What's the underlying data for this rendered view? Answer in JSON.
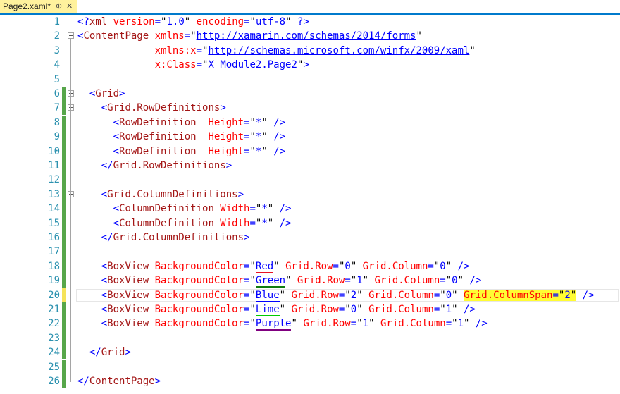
{
  "tab": {
    "title": "Page2.xaml*",
    "pin_glyph": "⊕",
    "close_glyph": "✕"
  },
  "colors": {
    "line_number": "#2b91af",
    "bracket": "#0000ff",
    "element": "#a31515",
    "attribute": "#ff0000",
    "string": "#0000ff",
    "change_saved": "#57a64a",
    "change_unsaved": "#f5e35a",
    "highlight": "#fffc33"
  },
  "lines": [
    {
      "n": "1",
      "change": "",
      "fold": false,
      "tokens": [
        [
          "br",
          "<?"
        ],
        [
          "el",
          "xml"
        ],
        [
          "at",
          " version"
        ],
        [
          "br",
          "="
        ],
        [
          "tx",
          "\""
        ],
        [
          "st",
          "1.0"
        ],
        [
          "tx",
          "\""
        ],
        [
          "at",
          " encoding"
        ],
        [
          "br",
          "="
        ],
        [
          "tx",
          "\""
        ],
        [
          "st",
          "utf-8"
        ],
        [
          "tx",
          "\""
        ],
        [
          "br",
          " ?>"
        ]
      ]
    },
    {
      "n": "2",
      "change": "",
      "fold": true,
      "tokens": [
        [
          "br",
          "<"
        ],
        [
          "el",
          "ContentPage"
        ],
        [
          "at",
          " xmlns"
        ],
        [
          "br",
          "="
        ],
        [
          "tx",
          "\""
        ],
        [
          "url",
          "http://xamarin.com/schemas/2014/forms"
        ],
        [
          "tx",
          "\""
        ]
      ]
    },
    {
      "n": "3",
      "change": "",
      "fold": false,
      "tokens": [
        [
          "tx",
          "             "
        ],
        [
          "at",
          "xmlns:x"
        ],
        [
          "br",
          "="
        ],
        [
          "tx",
          "\""
        ],
        [
          "url",
          "http://schemas.microsoft.com/winfx/2009/xaml"
        ],
        [
          "tx",
          "\""
        ]
      ]
    },
    {
      "n": "4",
      "change": "",
      "fold": false,
      "tokens": [
        [
          "tx",
          "             "
        ],
        [
          "at",
          "x:Class"
        ],
        [
          "br",
          "="
        ],
        [
          "tx",
          "\""
        ],
        [
          "st",
          "X_Module2.Page2"
        ],
        [
          "tx",
          "\""
        ],
        [
          "br",
          ">"
        ]
      ]
    },
    {
      "n": "5",
      "change": "",
      "fold": false,
      "tokens": []
    },
    {
      "n": "6",
      "change": "saved",
      "fold": true,
      "tokens": [
        [
          "tx",
          "  "
        ],
        [
          "br",
          "<"
        ],
        [
          "el",
          "Grid"
        ],
        [
          "br",
          ">"
        ]
      ]
    },
    {
      "n": "7",
      "change": "saved",
      "fold": true,
      "tokens": [
        [
          "tx",
          "    "
        ],
        [
          "br",
          "<"
        ],
        [
          "el",
          "Grid.RowDefinitions"
        ],
        [
          "br",
          ">"
        ]
      ]
    },
    {
      "n": "8",
      "change": "saved",
      "fold": false,
      "tokens": [
        [
          "tx",
          "      "
        ],
        [
          "br",
          "<"
        ],
        [
          "el",
          "RowDefinition"
        ],
        [
          "at",
          "  Height"
        ],
        [
          "br",
          "="
        ],
        [
          "tx",
          "\""
        ],
        [
          "st",
          "*"
        ],
        [
          "tx",
          "\""
        ],
        [
          "br",
          " />"
        ]
      ]
    },
    {
      "n": "9",
      "change": "saved",
      "fold": false,
      "tokens": [
        [
          "tx",
          "      "
        ],
        [
          "br",
          "<"
        ],
        [
          "el",
          "RowDefinition"
        ],
        [
          "at",
          "  Height"
        ],
        [
          "br",
          "="
        ],
        [
          "tx",
          "\""
        ],
        [
          "st",
          "*"
        ],
        [
          "tx",
          "\""
        ],
        [
          "br",
          " />"
        ]
      ]
    },
    {
      "n": "10",
      "change": "saved",
      "fold": false,
      "tokens": [
        [
          "tx",
          "      "
        ],
        [
          "br",
          "<"
        ],
        [
          "el",
          "RowDefinition"
        ],
        [
          "at",
          "  Height"
        ],
        [
          "br",
          "="
        ],
        [
          "tx",
          "\""
        ],
        [
          "st",
          "*"
        ],
        [
          "tx",
          "\""
        ],
        [
          "br",
          " />"
        ]
      ]
    },
    {
      "n": "11",
      "change": "saved",
      "fold": false,
      "tokens": [
        [
          "tx",
          "    "
        ],
        [
          "br",
          "</"
        ],
        [
          "el",
          "Grid.RowDefinitions"
        ],
        [
          "br",
          ">"
        ]
      ]
    },
    {
      "n": "12",
      "change": "saved",
      "fold": false,
      "tokens": []
    },
    {
      "n": "13",
      "change": "saved",
      "fold": true,
      "tokens": [
        [
          "tx",
          "    "
        ],
        [
          "br",
          "<"
        ],
        [
          "el",
          "Grid.ColumnDefinitions"
        ],
        [
          "br",
          ">"
        ]
      ]
    },
    {
      "n": "14",
      "change": "saved",
      "fold": false,
      "tokens": [
        [
          "tx",
          "      "
        ],
        [
          "br",
          "<"
        ],
        [
          "el",
          "ColumnDefinition"
        ],
        [
          "at",
          " Width"
        ],
        [
          "br",
          "="
        ],
        [
          "tx",
          "\""
        ],
        [
          "st",
          "*"
        ],
        [
          "tx",
          "\""
        ],
        [
          "br",
          " />"
        ]
      ]
    },
    {
      "n": "15",
      "change": "saved",
      "fold": false,
      "tokens": [
        [
          "tx",
          "      "
        ],
        [
          "br",
          "<"
        ],
        [
          "el",
          "ColumnDefinition"
        ],
        [
          "at",
          " Width"
        ],
        [
          "br",
          "="
        ],
        [
          "tx",
          "\""
        ],
        [
          "st",
          "*"
        ],
        [
          "tx",
          "\""
        ],
        [
          "br",
          " />"
        ]
      ]
    },
    {
      "n": "16",
      "change": "saved",
      "fold": false,
      "tokens": [
        [
          "tx",
          "    "
        ],
        [
          "br",
          "</"
        ],
        [
          "el",
          "Grid.ColumnDefinitions"
        ],
        [
          "br",
          ">"
        ]
      ]
    },
    {
      "n": "17",
      "change": "saved",
      "fold": false,
      "tokens": []
    },
    {
      "n": "18",
      "change": "saved",
      "fold": false,
      "tokens": [
        [
          "tx",
          "    "
        ],
        [
          "br",
          "<"
        ],
        [
          "el",
          "BoxView"
        ],
        [
          "at",
          " BackgroundColor"
        ],
        [
          "br",
          "="
        ],
        [
          "tx",
          "\""
        ],
        [
          "st",
          "Red",
          "ul-red"
        ],
        [
          "tx",
          "\""
        ],
        [
          "at",
          " Grid.Row"
        ],
        [
          "br",
          "="
        ],
        [
          "tx",
          "\""
        ],
        [
          "st",
          "0"
        ],
        [
          "tx",
          "\""
        ],
        [
          "at",
          " Grid.Column"
        ],
        [
          "br",
          "="
        ],
        [
          "tx",
          "\""
        ],
        [
          "st",
          "0"
        ],
        [
          "tx",
          "\""
        ],
        [
          "br",
          " />"
        ]
      ]
    },
    {
      "n": "19",
      "change": "saved",
      "fold": false,
      "tokens": [
        [
          "tx",
          "    "
        ],
        [
          "br",
          "<"
        ],
        [
          "el",
          "BoxView"
        ],
        [
          "at",
          " BackgroundColor"
        ],
        [
          "br",
          "="
        ],
        [
          "tx",
          "\""
        ],
        [
          "st",
          "Green",
          "ul-green"
        ],
        [
          "tx",
          "\""
        ],
        [
          "at",
          " Grid.Row"
        ],
        [
          "br",
          "="
        ],
        [
          "tx",
          "\""
        ],
        [
          "st",
          "1"
        ],
        [
          "tx",
          "\""
        ],
        [
          "at",
          " Grid.Column"
        ],
        [
          "br",
          "="
        ],
        [
          "tx",
          "\""
        ],
        [
          "st",
          "0"
        ],
        [
          "tx",
          "\""
        ],
        [
          "br",
          " />"
        ]
      ]
    },
    {
      "n": "20",
      "change": "unsaved",
      "fold": false,
      "current": true,
      "tokens": [
        [
          "tx",
          "    "
        ],
        [
          "br",
          "<"
        ],
        [
          "el",
          "BoxView"
        ],
        [
          "at",
          " BackgroundColor"
        ],
        [
          "br",
          "="
        ],
        [
          "tx",
          "\""
        ],
        [
          "st",
          "Blue",
          "ul-blue"
        ],
        [
          "tx",
          "\""
        ],
        [
          "at",
          " Grid.Row"
        ],
        [
          "br",
          "="
        ],
        [
          "tx",
          "\""
        ],
        [
          "st",
          "2"
        ],
        [
          "tx",
          "\""
        ],
        [
          "at",
          " Grid.Column"
        ],
        [
          "br",
          "="
        ],
        [
          "tx",
          "\""
        ],
        [
          "st",
          "0"
        ],
        [
          "tx",
          "\""
        ],
        [
          "tx",
          " "
        ],
        [
          "at",
          "Grid.ColumnSpan",
          "hl"
        ],
        [
          "br",
          "=",
          "hl"
        ],
        [
          "tx",
          "\"",
          "hl"
        ],
        [
          "st",
          "2",
          "hl"
        ],
        [
          "tx",
          "\"",
          "hl"
        ],
        [
          "br",
          " />"
        ]
      ]
    },
    {
      "n": "21",
      "change": "saved",
      "fold": false,
      "tokens": [
        [
          "tx",
          "    "
        ],
        [
          "br",
          "<"
        ],
        [
          "el",
          "BoxView"
        ],
        [
          "at",
          " BackgroundColor"
        ],
        [
          "br",
          "="
        ],
        [
          "tx",
          "\""
        ],
        [
          "st",
          "Lime",
          "ul-lime"
        ],
        [
          "tx",
          "\""
        ],
        [
          "at",
          " Grid.Row"
        ],
        [
          "br",
          "="
        ],
        [
          "tx",
          "\""
        ],
        [
          "st",
          "0"
        ],
        [
          "tx",
          "\""
        ],
        [
          "at",
          " Grid.Column"
        ],
        [
          "br",
          "="
        ],
        [
          "tx",
          "\""
        ],
        [
          "st",
          "1"
        ],
        [
          "tx",
          "\""
        ],
        [
          "br",
          " />"
        ]
      ]
    },
    {
      "n": "22",
      "change": "saved",
      "fold": false,
      "tokens": [
        [
          "tx",
          "    "
        ],
        [
          "br",
          "<"
        ],
        [
          "el",
          "BoxView"
        ],
        [
          "at",
          " BackgroundColor"
        ],
        [
          "br",
          "="
        ],
        [
          "tx",
          "\""
        ],
        [
          "st",
          "Purple",
          "ul-purple"
        ],
        [
          "tx",
          "\""
        ],
        [
          "at",
          " Grid.Row"
        ],
        [
          "br",
          "="
        ],
        [
          "tx",
          "\""
        ],
        [
          "st",
          "1"
        ],
        [
          "tx",
          "\""
        ],
        [
          "at",
          " Grid.Column"
        ],
        [
          "br",
          "="
        ],
        [
          "tx",
          "\""
        ],
        [
          "st",
          "1"
        ],
        [
          "tx",
          "\""
        ],
        [
          "br",
          " />"
        ]
      ]
    },
    {
      "n": "23",
      "change": "saved",
      "fold": false,
      "tokens": []
    },
    {
      "n": "24",
      "change": "saved",
      "fold": false,
      "tokens": [
        [
          "tx",
          "  "
        ],
        [
          "br",
          "</"
        ],
        [
          "el",
          "Grid"
        ],
        [
          "br",
          ">"
        ]
      ]
    },
    {
      "n": "25",
      "change": "saved",
      "fold": false,
      "tokens": []
    },
    {
      "n": "26",
      "change": "saved",
      "fold": false,
      "tokens": [
        [
          "br",
          "</"
        ],
        [
          "el",
          "ContentPage"
        ],
        [
          "br",
          ">"
        ]
      ]
    }
  ]
}
